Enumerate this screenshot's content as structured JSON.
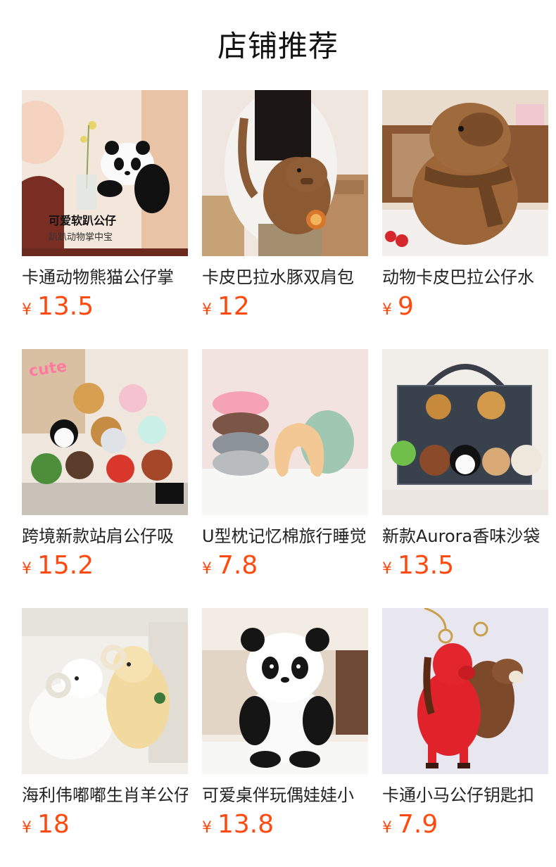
{
  "header": {
    "title": "店铺推荐"
  },
  "currency_symbol": "¥",
  "products": [
    {
      "name": "卡通动物熊猫公仔掌",
      "price": "13.5",
      "image": "panda-plush-held-icon",
      "overlay_title": "可爱软趴公仔",
      "overlay_sub": "趴趴动物掌中宝"
    },
    {
      "name": "卡皮巴拉水豚双肩包",
      "price": "12",
      "image": "capybara-backpack-icon"
    },
    {
      "name": "动物卡皮巴拉公仔水",
      "price": "9",
      "image": "capybara-scarf-plush-icon"
    },
    {
      "name": "跨境新款站肩公仔吸",
      "price": "15.2",
      "image": "shoulder-plush-group-icon",
      "overlay_title": "cute"
    },
    {
      "name": "U型枕记忆棉旅行睡觉",
      "price": "7.8",
      "image": "u-pillow-icon"
    },
    {
      "name": "新款Aurora香味沙袋",
      "price": "13.5",
      "image": "aurora-plush-group-icon"
    },
    {
      "name": "海利伟嘟嘟生肖羊公仔",
      "price": "18",
      "image": "sheep-plush-icon"
    },
    {
      "name": "可爱桌伴玩偶娃娃小",
      "price": "13.8",
      "image": "panda-desk-plush-icon"
    },
    {
      "name": "卡通小马公仔钥匙扣",
      "price": "7.9",
      "image": "horse-keychain-icon"
    }
  ]
}
